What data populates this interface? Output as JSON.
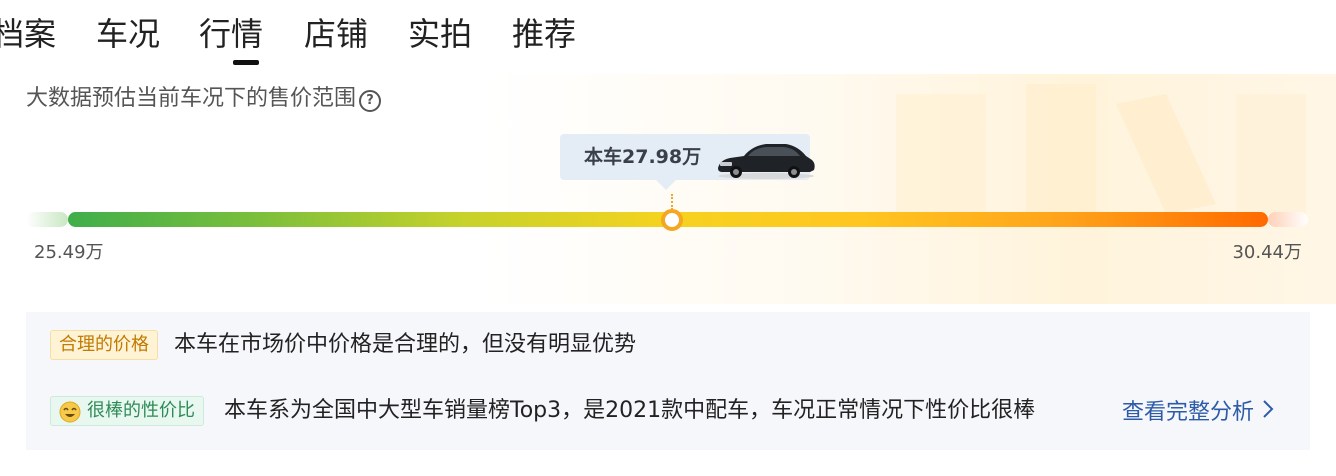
{
  "tabs": [
    {
      "label": "档案"
    },
    {
      "label": "车况"
    },
    {
      "label": "行情",
      "active": true
    },
    {
      "label": "店铺"
    },
    {
      "label": "实拍"
    },
    {
      "label": "推荐"
    }
  ],
  "price_estimate": {
    "title": "大数据预估当前车况下的售价范围",
    "current_price_label": "本车27.98万",
    "min_label": "25.49万",
    "max_label": "30.44万",
    "range_min": 25.49,
    "range_max": 30.44,
    "current_price": 27.98
  },
  "analysis": {
    "price_tag": "合理的价格",
    "price_text": "本车在市场价中价格是合理的，但没有明显优势",
    "value_tag": "很棒的性价比",
    "value_text": "本车系为全国中大型车销量榜Top3，是2021款中配车，车况正常情况下性价比很棒",
    "link_text": "查看完整分析"
  },
  "colors": {
    "bar_start": "#3fae4a",
    "bar_mid": "#f5d31f",
    "bar_end": "#ff6a00",
    "marker": "#f5a623",
    "link": "#2d5ba8",
    "price_tag_text": "#c27a00",
    "value_tag_text": "#2e8b57"
  },
  "icons": {
    "help": "question-circle-icon",
    "car": "car-photo",
    "value_tag": "smile-face-icon",
    "link_arrow": "chevron-right-icon"
  }
}
